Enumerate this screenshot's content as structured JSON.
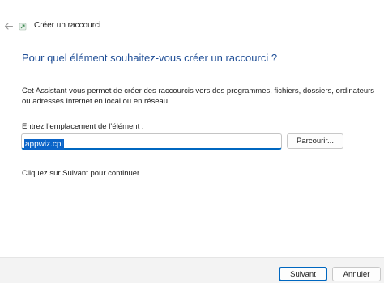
{
  "window": {
    "title": "Créer un raccourci"
  },
  "main": {
    "heading": "Pour quel élément souhaitez-vous créer un raccourci ?",
    "description": "Cet Assistant vous permet de créer des raccourcis vers des programmes, fichiers, dossiers, ordinateurs ou adresses Internet en local ou en réseau.",
    "location_label": "Entrez l’emplacement de l’élément :",
    "location_value": "appwiz.cpl",
    "browse_label": "Parcourir...",
    "hint": "Cliquez sur Suivant pour continuer."
  },
  "footer": {
    "next_label": "Suivant",
    "cancel_label": "Annuler"
  },
  "icons": {
    "back": "back-arrow-icon",
    "app": "shortcut-icon"
  },
  "colors": {
    "heading": "#1f4e96",
    "accent": "#0067c0",
    "selection": "#0a64c8",
    "footer_bg": "#f3f3f3"
  }
}
